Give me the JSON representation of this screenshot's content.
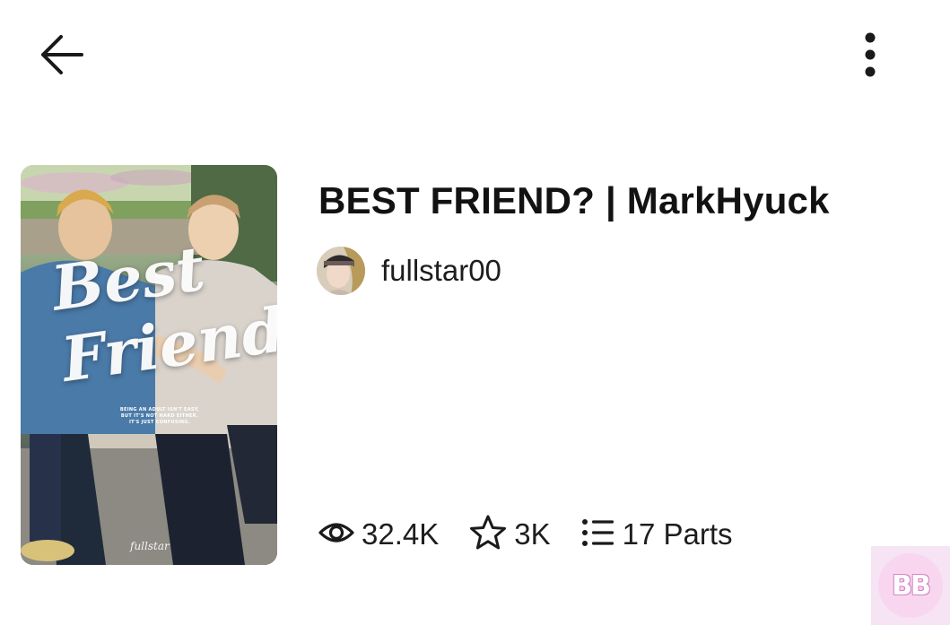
{
  "story": {
    "title": "BEST FRIEND? | MarkHyuck",
    "author": "fullstar00",
    "cover": {
      "title_text": "Best\nFriend?",
      "tagline": "BEING AN ADULT ISN'T EASY, BUT IT'S NOT HARD EITHER. IT'S JUST CONFUSING.",
      "signature": "fullstar"
    },
    "stats": {
      "reads": "32.4K",
      "votes": "3K",
      "parts": "17 Parts"
    }
  },
  "icons": {
    "back": "arrow-left-icon",
    "more": "more-vertical-icon",
    "reads": "eye-icon",
    "votes": "star-icon",
    "parts": "list-icon"
  },
  "watermark": {
    "text": "BB"
  },
  "colors": {
    "text": "#121212",
    "background": "#ffffff",
    "watermark_bg": "#f6e4f4",
    "watermark_accent": "#d487c6"
  }
}
